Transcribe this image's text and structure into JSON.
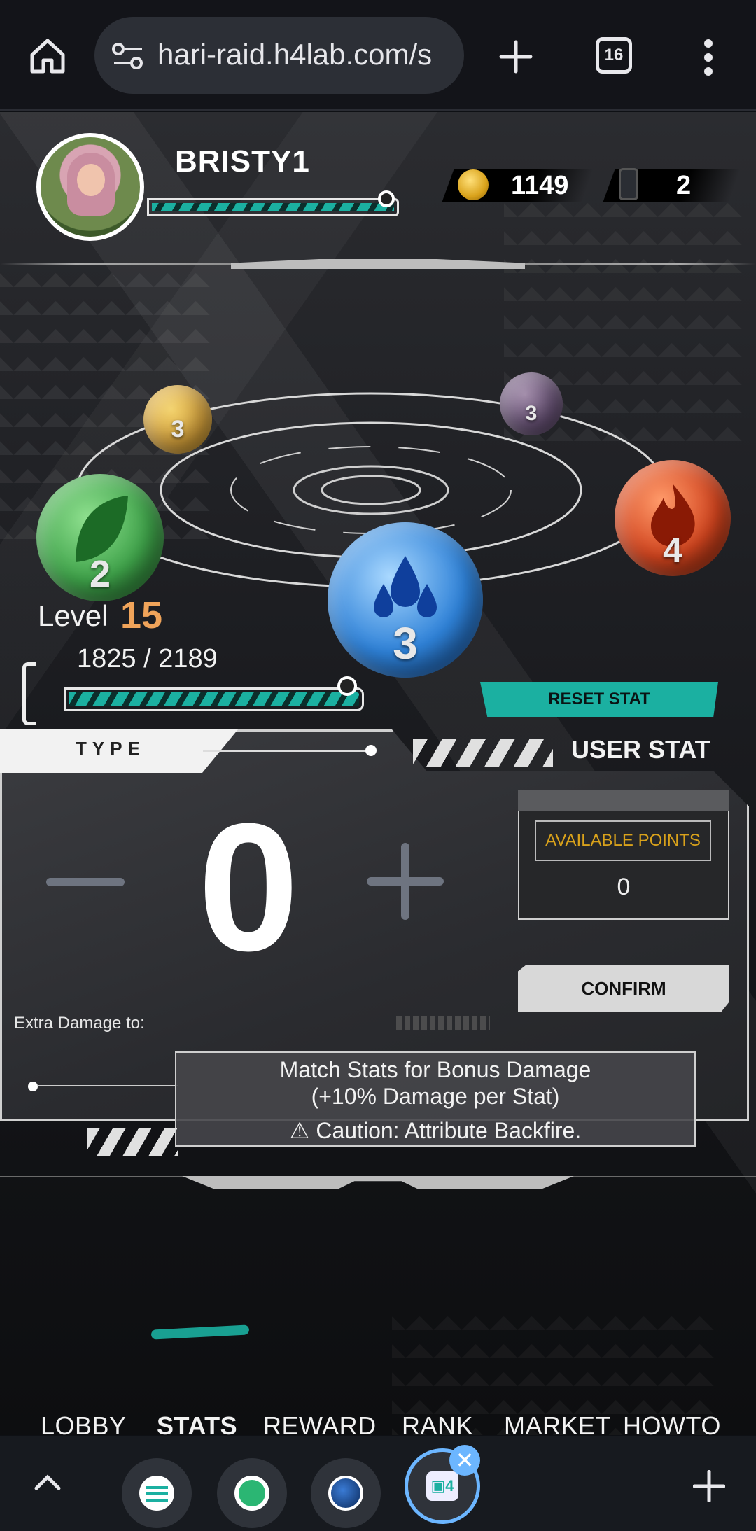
{
  "browser": {
    "url": "hari-raid.h4lab.com/s",
    "tab_count": "16",
    "icons": [
      "home-icon",
      "site-settings-icon",
      "new-tab-icon",
      "tab-switcher-icon",
      "more-vert-icon"
    ]
  },
  "player": {
    "name": "BRISTY1",
    "coins": "1149",
    "tickets": "2",
    "level_label": "Level",
    "level_value": "15",
    "xp_text": "1825 / 2189",
    "xp_fraction": 0.834
  },
  "orbs": [
    {
      "element": "nature",
      "count": "2",
      "color": "#3fa34a"
    },
    {
      "element": "light",
      "count": "3",
      "color": "#d6a23c"
    },
    {
      "element": "water",
      "count": "3",
      "color": "#2f82d8"
    },
    {
      "element": "dark",
      "count": "3",
      "color": "#6a5478"
    },
    {
      "element": "fire",
      "count": "4",
      "color": "#d2451f"
    }
  ],
  "stats_panel": {
    "reset_label": "RESET STAT",
    "type_label": "TYPE",
    "user_stat_label": "USER STAT",
    "value": "0",
    "available_label": "AVAILABLE POINTS",
    "available_value": "0",
    "confirm_label": "CONFIRM",
    "extra_damage_label": "Extra Damage to:",
    "info_line1": "Match Stats for Bonus Damage",
    "info_line2": "(+10% Damage per Stat)",
    "info_line3": "⚠ Caution: Attribute Backfire."
  },
  "nav": {
    "items": [
      "LOBBY",
      "STATS",
      "REWARD",
      "RANK",
      "MARKET",
      "HOWTO"
    ],
    "active": "STATS"
  },
  "colors": {
    "accent": "#1bb0a1",
    "level": "#f0a45a",
    "gold": "#d9a21b"
  }
}
